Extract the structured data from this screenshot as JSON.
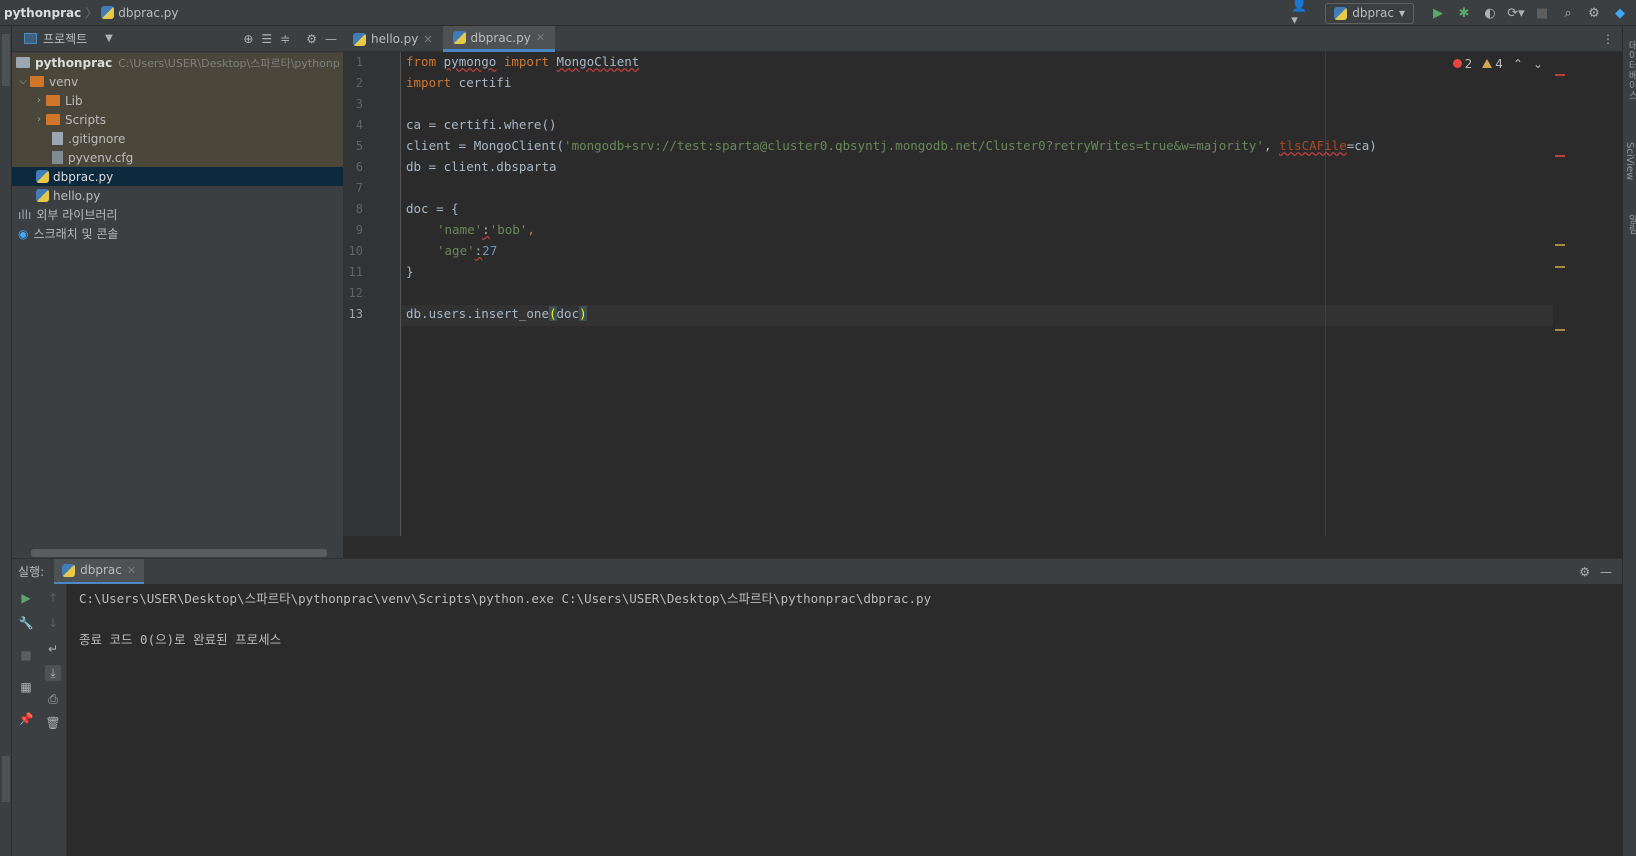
{
  "titlebar": {
    "project": "pythonprac",
    "file": "dbprac.py",
    "run_config": "dbprac"
  },
  "project_panel": {
    "title": "프로젝트",
    "tree": [
      {
        "label": "pythonprac",
        "path": "C:\\Users\\USER\\Desktop\\스파르타\\pythonp",
        "type": "folder-root"
      },
      {
        "label": "venv",
        "type": "folder"
      },
      {
        "label": "Lib",
        "type": "folder"
      },
      {
        "label": "Scripts",
        "type": "folder"
      },
      {
        "label": ".gitignore",
        "type": "file"
      },
      {
        "label": "pyvenv.cfg",
        "type": "file"
      },
      {
        "label": "dbprac.py",
        "type": "python",
        "selected": true
      },
      {
        "label": "hello.py",
        "type": "python"
      },
      {
        "label": "외부 라이브러리",
        "type": "library"
      },
      {
        "label": "스크래치 및 콘솔",
        "type": "scratch"
      }
    ]
  },
  "editor": {
    "tabs": [
      {
        "label": "hello.py",
        "active": false
      },
      {
        "label": "dbprac.py",
        "active": true
      }
    ],
    "errors": "2",
    "warnings": "4",
    "lines": [
      "1",
      "2",
      "3",
      "4",
      "5",
      "6",
      "7",
      "8",
      "9",
      "10",
      "11",
      "12",
      "13"
    ],
    "code": {
      "l1_from": "from",
      "l1_mod": "pymongo",
      "l1_import": "import",
      "l1_name": "MongoClient",
      "l2_import": "import",
      "l2_mod": " certifi",
      "l4": "ca = certifi.where()",
      "l5_a": "client = MongoClient(",
      "l5_str": "'mongodb+srv://test:sparta@cluster0.qbsyntj.mongodb.net/Cluster0?retryWrites=true&w=majority'",
      "l5_comma": ", ",
      "l5_param": "tlsCAFile",
      "l5_b": "=ca)",
      "l6": "db = client.dbsparta",
      "l8": "doc = {",
      "l9_key": "'name'",
      "l9_colon": ":",
      "l9_val": "'bob'",
      "l9_end": ",",
      "l10_key": "'age'",
      "l10_colon": ":",
      "l10_val": "27",
      "l11": "}",
      "l13_a": "db.users.insert_one",
      "l13_open": "(",
      "l13_arg": "doc",
      "l13_close": ")"
    }
  },
  "run_panel": {
    "label": "실행:",
    "tab": "dbprac",
    "output": [
      "C:\\Users\\USER\\Desktop\\스파르타\\pythonprac\\venv\\Scripts\\python.exe C:\\Users\\USER\\Desktop\\스파르타\\pythonprac\\dbprac.py",
      "종료 코드 0(으)로 완료된 프로세스"
    ]
  },
  "side_labels": {
    "right_top": "데이터베이스",
    "right_mid": "SciView",
    "right_bottom": "알림"
  }
}
